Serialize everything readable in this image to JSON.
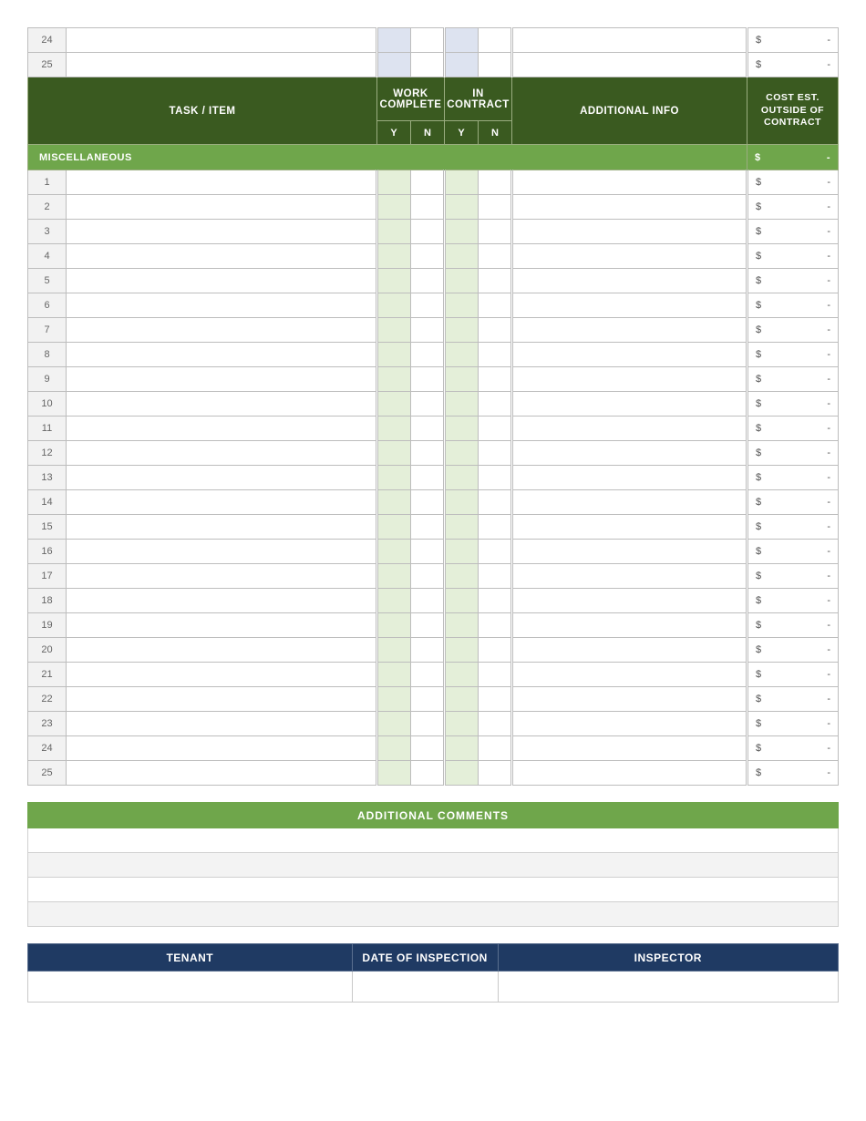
{
  "top_rows": [
    24,
    25
  ],
  "header": {
    "task": "TASK / ITEM",
    "work_complete": "WORK COMPLETE",
    "in_contract": "IN CONTRACT",
    "additional_info": "ADDITIONAL INFO",
    "cost": "COST EST. OUTSIDE OF CONTRACT",
    "y": "Y",
    "n": "N"
  },
  "section": {
    "label": "MISCELLANEOUS",
    "cost_symbol": "$",
    "cost_dash": "-"
  },
  "misc_rows": [
    1,
    2,
    3,
    4,
    5,
    6,
    7,
    8,
    9,
    10,
    11,
    12,
    13,
    14,
    15,
    16,
    17,
    18,
    19,
    20,
    21,
    22,
    23,
    24,
    25
  ],
  "row_cost": {
    "symbol": "$",
    "dash": "-"
  },
  "comments": {
    "title": "ADDITIONAL COMMENTS",
    "rows": 4
  },
  "footer": {
    "tenant": "TENANT",
    "date": "DATE OF INSPECTION",
    "inspector": "INSPECTOR"
  }
}
